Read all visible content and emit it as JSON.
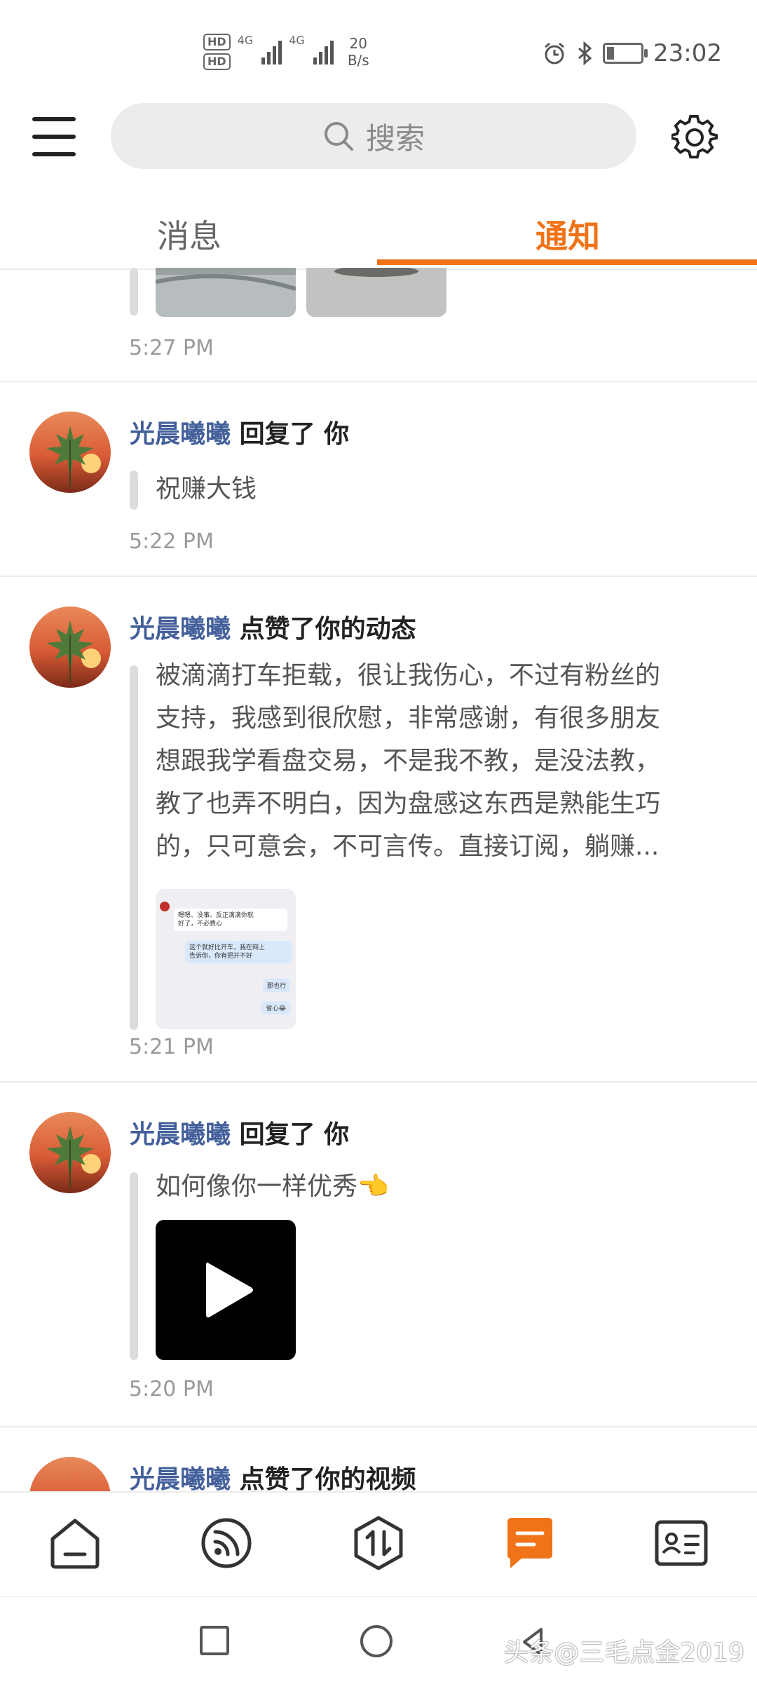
{
  "status_bar": {
    "hd1": "HD",
    "hd2": "HD",
    "net1": "4G",
    "net2": "4G",
    "speed_value": "20",
    "speed_unit": "B/s",
    "time": "23:02",
    "icons": [
      "alarm-icon",
      "bluetooth-icon",
      "battery-icon"
    ],
    "battery_level": 0.2
  },
  "header": {
    "search_placeholder": "搜索",
    "icons": [
      "menu-icon",
      "search-icon",
      "gear-icon"
    ]
  },
  "tabs": [
    {
      "label": "消息",
      "active": false
    },
    {
      "label": "通知",
      "active": true
    }
  ],
  "colors": {
    "accent": "#f07318",
    "username": "#44609b",
    "divider": "#ececec"
  },
  "notifications": [
    {
      "time": "5:27 PM"
    },
    {
      "user": "光晨曦曦",
      "action": "回复了 你",
      "text": "祝赚大钱",
      "time": "5:22 PM"
    },
    {
      "user": "光晨曦曦",
      "action": "点赞了你的动态",
      "lines": [
        "被滴滴打车拒载，很让我伤心，不过有粉丝的",
        "支持，我感到很欣慰，非常感谢，有很多朋友",
        "想跟我学看盘交易，不是我不教，是没法教，",
        "教了也弄不明白，因为盘感这东西是熟能生巧",
        "的，只可意会，不可言传。直接订阅，躺赚..."
      ],
      "chat_lines": [
        "嗯嗯、没事、反正滴滴你就",
        "好了，不必费心",
        "这个就好比开车，我在网上",
        "告诉你，你有把开不好",
        "那也行",
        "省心😂"
      ],
      "time": "5:21 PM"
    },
    {
      "user": "光晨曦曦",
      "action": "回复了 你",
      "text": "如何像你一样优秀👈",
      "time": "5:20 PM"
    },
    {
      "user": "光晨曦曦",
      "action": "点赞了你的视频"
    }
  ],
  "bottom_nav": [
    "home-icon",
    "feed-icon",
    "trade-icon",
    "messages-icon",
    "profile-card-icon"
  ],
  "watermark": "头条@三毛点金2019"
}
